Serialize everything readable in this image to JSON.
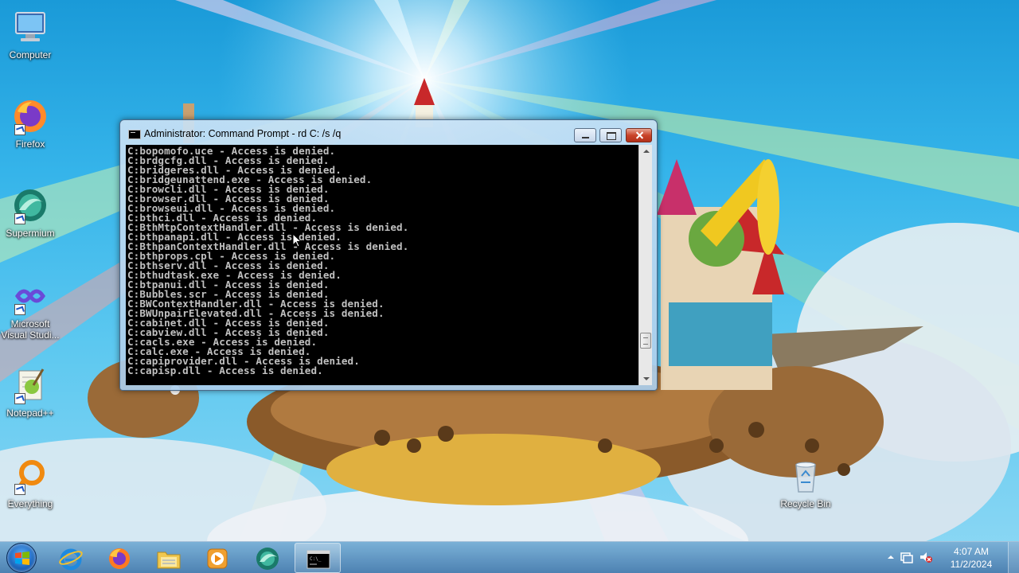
{
  "desktop": {
    "icons": [
      {
        "label": "Computer"
      },
      {
        "label": "Firefox"
      },
      {
        "label": "Supermium"
      },
      {
        "label": "Microsoft Visual Studi..."
      },
      {
        "label": "Notepad++"
      },
      {
        "label": "Everything"
      },
      {
        "label": "Recycle Bin"
      }
    ]
  },
  "cmd_window": {
    "title": "Administrator:  Command Prompt - rd  C: /s /q",
    "lines": [
      "C:bopomofo.uce - Access is denied.",
      "C:brdgcfg.dll - Access is denied.",
      "C:bridgeres.dll - Access is denied.",
      "C:bridgeunattend.exe - Access is denied.",
      "C:browcli.dll - Access is denied.",
      "C:browser.dll - Access is denied.",
      "C:browseui.dll - Access is denied.",
      "C:bthci.dll - Access is denied.",
      "C:BthMtpContextHandler.dll - Access is denied.",
      "C:bthpanapi.dll - Access is denied.",
      "C:BthpanContextHandler.dll - Access is denied.",
      "C:bthprops.cpl - Access is denied.",
      "C:bthserv.dll - Access is denied.",
      "C:bthudtask.exe - Access is denied.",
      "C:btpanui.dll - Access is denied.",
      "C:Bubbles.scr - Access is denied.",
      "C:BWContextHandler.dll - Access is denied.",
      "C:BWUnpairElevated.dll - Access is denied.",
      "C:cabinet.dll - Access is denied.",
      "C:cabview.dll - Access is denied.",
      "C:cacls.exe - Access is denied.",
      "C:calc.exe - Access is denied.",
      "C:capiprovider.dll - Access is denied.",
      "C:capisp.dll - Access is denied."
    ]
  },
  "taskbar": {
    "pinned": [
      {
        "icon": "internet-explorer-icon"
      },
      {
        "icon": "firefox-icon"
      },
      {
        "icon": "file-explorer-icon"
      },
      {
        "icon": "media-player-icon"
      },
      {
        "icon": "supermium-icon"
      },
      {
        "icon": "command-prompt-icon",
        "active": true
      }
    ],
    "clock": {
      "time": "4:07 AM",
      "date": "11/2/2024"
    }
  }
}
